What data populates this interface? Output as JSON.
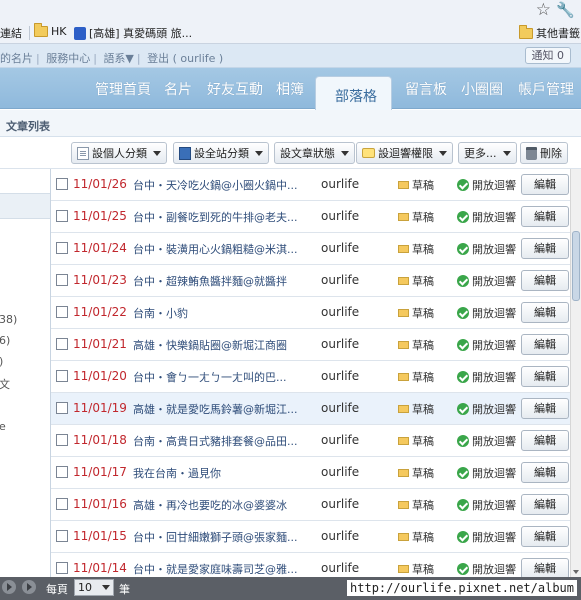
{
  "browser": {
    "bookmarks": [
      {
        "label": "連結",
        "icon": "none"
      },
      {
        "label": "HK",
        "icon": "folder-icon"
      },
      {
        "label": "[高雄] 真愛碼頭 旅...",
        "icon": "site-favicon"
      },
      {
        "label": "其他書籤",
        "icon": "folder-icon"
      }
    ]
  },
  "topstrip": {
    "links": [
      "的名片",
      "服務中心",
      "語系▼",
      "登出 ( ourlife )"
    ],
    "notice": "通知 0"
  },
  "nav": {
    "items": [
      "管理首頁",
      "名片",
      "好友互動",
      "相簿",
      "部落格",
      "留言板",
      "小圈圈",
      "帳戶管理"
    ],
    "active": "部落格"
  },
  "section": {
    "title": "文章列表"
  },
  "toolbar": {
    "personal_category": "設個人分類",
    "site_category": "設全站分類",
    "article_status": "設文章狀態",
    "reply_permission": "設迴響權限",
    "more": "更多...",
    "delete": "刪除"
  },
  "sidebar": {
    "fragments": [
      "38)",
      "6)",
      ")",
      "文",
      "e"
    ]
  },
  "articles": [
    {
      "date": "11/01/26",
      "title": "台中・天冷吃火鍋@小圈火鍋中...",
      "author": "ourlife",
      "status": "草稿",
      "permission": "開放迴響",
      "edit": "編輯"
    },
    {
      "date": "11/01/25",
      "title": "台中・副餐吃到死的牛排@老夫...",
      "author": "ourlife",
      "status": "草稿",
      "permission": "開放迴響",
      "edit": "編輯"
    },
    {
      "date": "11/01/24",
      "title": "台中・裝潢用心火鍋粗糙@米淇...",
      "author": "ourlife",
      "status": "草稿",
      "permission": "開放迴響",
      "edit": "編輯"
    },
    {
      "date": "11/01/23",
      "title": "台中・超辣鮪魚醬拌麵@就醬拌",
      "author": "ourlife",
      "status": "草稿",
      "permission": "開放迴響",
      "edit": "編輯"
    },
    {
      "date": "11/01/22",
      "title": "台南・小豹",
      "author": "ourlife",
      "status": "草稿",
      "permission": "開放迴響",
      "edit": "編輯"
    },
    {
      "date": "11/01/21",
      "title": "高雄・快樂鍋貼圈@新堀江商圈",
      "author": "ourlife",
      "status": "草稿",
      "permission": "開放迴響",
      "edit": "編輯"
    },
    {
      "date": "11/01/20",
      "title": "台中・會ㄅ一ㄤㄅ一ㄤ叫的巴...",
      "author": "ourlife",
      "status": "草稿",
      "permission": "開放迴響",
      "edit": "編輯"
    },
    {
      "date": "11/01/19",
      "title": "高雄・就是愛吃馬鈴薯@新堀江...",
      "author": "ourlife",
      "status": "草稿",
      "permission": "開放迴響",
      "edit": "編輯"
    },
    {
      "date": "11/01/18",
      "title": "台南・高貴日式豬排套餐@品田...",
      "author": "ourlife",
      "status": "草稿",
      "permission": "開放迴響",
      "edit": "編輯"
    },
    {
      "date": "11/01/17",
      "title": "我在台南・過見你",
      "author": "ourlife",
      "status": "草稿",
      "permission": "開放迴響",
      "edit": "編輯"
    },
    {
      "date": "11/01/16",
      "title": "高雄・再冷也要吃的冰@婆婆冰",
      "author": "ourlife",
      "status": "草稿",
      "permission": "開放迴響",
      "edit": "編輯"
    },
    {
      "date": "11/01/15",
      "title": "台中・回甘細嫩獅子頭@張家麵...",
      "author": "ourlife",
      "status": "草稿",
      "permission": "開放迴響",
      "edit": "編輯"
    },
    {
      "date": "11/01/14",
      "title": "台中・就是愛家庭味壽司芝@雅...",
      "author": "ourlife",
      "status": "草稿",
      "permission": "開放迴響",
      "edit": "編輯"
    }
  ],
  "footer": {
    "per_page_label": "每頁",
    "per_page_value": "10",
    "per_page_unit": "筆",
    "watermark": "http://ourlife.pixnet.net/album"
  }
}
